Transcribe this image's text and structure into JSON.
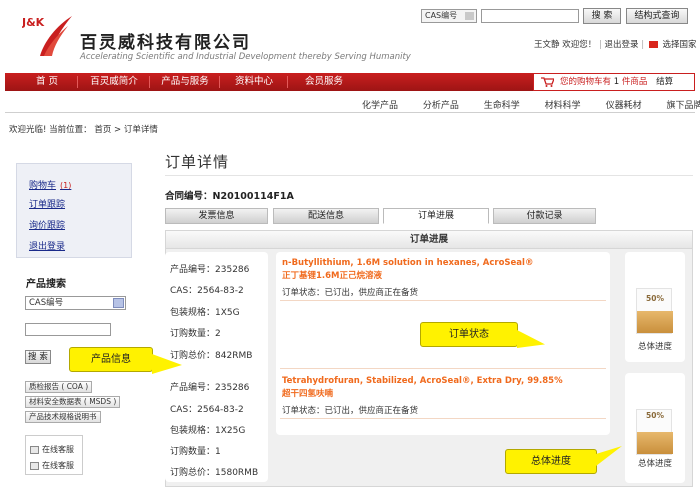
{
  "brand": {
    "logo_text": "J&K",
    "name": "百灵威科技有限公司",
    "slogan": "Accelerating Scientific and Industrial Development thereby Serving Humanity"
  },
  "top_search": {
    "select_value": "CAS编号",
    "search_label": "搜 索",
    "structure_label": "结构式查询"
  },
  "user_bar": {
    "username": "王文静",
    "welcome": "欢迎您！",
    "logout": "退出登录",
    "country": "选择国家"
  },
  "nav": {
    "items": [
      "首 页",
      "百灵威简介",
      "产品与服务",
      "资料中心",
      "会员服务"
    ],
    "cart_prefix": "您的购物车有",
    "cart_count": "1",
    "cart_suffix": "件商品",
    "checkout": "结算"
  },
  "sub_nav": [
    "化学产品",
    "分析产品",
    "生命科学",
    "材料科学",
    "仪器耗材",
    "旗下品牌"
  ],
  "breadcrumb": {
    "prefix": "欢迎光临! 当前位置：",
    "home": "首页",
    "sep": ">",
    "current": "订单详情"
  },
  "sidebar": {
    "links": [
      {
        "label": "购物车",
        "badge": "(1)"
      },
      {
        "label": "订单跟踪"
      },
      {
        "label": "询价跟踪"
      },
      {
        "label": "退出登录"
      }
    ],
    "product_search_title": "产品搜索",
    "select_value": "CAS编号",
    "search_label": "搜 索",
    "docs": [
      "质检报告 ( COA )",
      "材料安全数据表 ( MSDS )",
      "产品技术规格说明书"
    ],
    "service": [
      "在线客服",
      "在线客服"
    ]
  },
  "main": {
    "title": "订单详情",
    "contract_label": "合同编号：",
    "contract_no": "N20100114F1A",
    "tabs": [
      "发票信息",
      "配送信息",
      "订单进展",
      "付款记录"
    ],
    "panel_title": "订单进展"
  },
  "orders": [
    {
      "product_no_label": "产品编号：",
      "product_no": "235286",
      "cas_label": "CAS：",
      "cas": "2564-83-2",
      "pack_label": "包装规格：",
      "pack": "1X5G",
      "qty_label": "订购数量：",
      "qty": "2",
      "total_label": "订购总价：",
      "total": "842RMB",
      "name_en": "n-Butyllithium, 1.6M solution in hexanes, AcroSeal®",
      "name_cn": "正丁基锂1.6M正己烷溶液",
      "status_label": "订单状态：",
      "status": "已订出，供应商正在备货",
      "progress_pct": 50,
      "progress_text": "50%",
      "progress_label": "总体进度"
    },
    {
      "product_no_label": "产品编号：",
      "product_no": "235286",
      "cas_label": "CAS：",
      "cas": "2564-83-2",
      "pack_label": "包装规格：",
      "pack": "1X25G",
      "qty_label": "订购数量：",
      "qty": "1",
      "total_label": "订购总价：",
      "total": "1580RMB",
      "name_en": "Tetrahydrofuran, Stabilized, AcroSeal®, Extra Dry, 99.85%",
      "name_cn": "超干四氢呋喃",
      "status_label": "订单状态：",
      "status": "已订出，供应商正在备货",
      "progress_pct": 50,
      "progress_text": "50%",
      "progress_label": "总体进度"
    }
  ],
  "callouts": {
    "product_info": "产品信息",
    "order_status": "订单状态",
    "overall_progress": "总体进度"
  },
  "colors": {
    "brand_red": "#c91f1f",
    "order_orange": "#f06a1d",
    "callout_yellow": "#fff200",
    "overlay": "#7a7a7a"
  }
}
